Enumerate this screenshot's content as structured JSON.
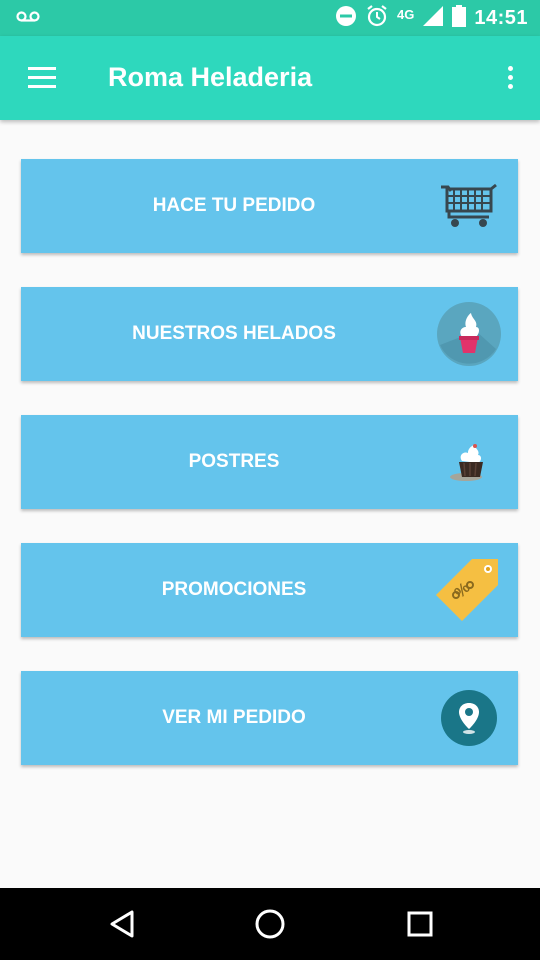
{
  "status_bar": {
    "network": "4G",
    "time": "14:51"
  },
  "app_bar": {
    "title": "Roma Heladeria"
  },
  "menu_items": [
    {
      "label": "HACE TU PEDIDO",
      "icon": "shopping-cart-icon"
    },
    {
      "label": "NUESTROS HELADOS",
      "icon": "ice-cream-icon"
    },
    {
      "label": "POSTRES",
      "icon": "cupcake-icon"
    },
    {
      "label": "PROMOCIONES",
      "icon": "discount-tag-icon"
    },
    {
      "label": "VER MI PEDIDO",
      "icon": "location-pin-icon"
    }
  ],
  "colors": {
    "status_bar": "#2cc9a7",
    "app_bar": "#2ed8bd",
    "card": "#64c4ec",
    "background": "#fafafa"
  }
}
